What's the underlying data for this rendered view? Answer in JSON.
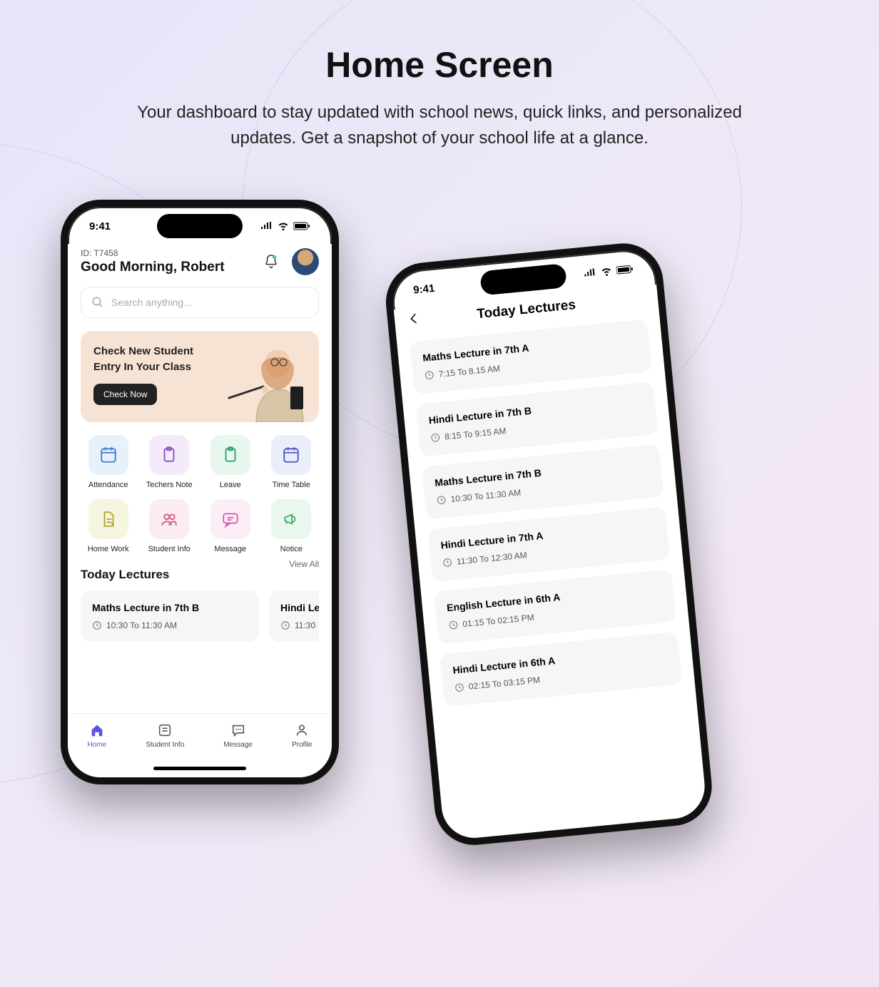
{
  "page": {
    "title": "Home Screen",
    "subtitle": "Your dashboard to stay updated with school news, quick links, and personalized updates. Get a snapshot of your school life at a glance."
  },
  "statusbar": {
    "time": "9:41"
  },
  "phone1": {
    "user_id": "ID: T7458",
    "greeting": "Good Morning, Robert",
    "search_placeholder": "Search anything...",
    "banner": {
      "title": "Check New Student Entry In Your Class",
      "button": "Check Now"
    },
    "tiles": [
      {
        "label": "Attendance",
        "bg": "#e6f1fb",
        "icon": "calendar",
        "iconColor": "#3f79d6"
      },
      {
        "label": "Techers Note",
        "bg": "#f5eaf9",
        "icon": "clipboard",
        "iconColor": "#8a4ec2"
      },
      {
        "label": "Leave",
        "bg": "#e7f7ee",
        "icon": "clipboard",
        "iconColor": "#2fa26b"
      },
      {
        "label": "Time Table",
        "bg": "#eaeefb",
        "icon": "calendar",
        "iconColor": "#4d54c6"
      },
      {
        "label": "Home Work",
        "bg": "#f6f5df",
        "icon": "document",
        "iconColor": "#b0a728"
      },
      {
        "label": "Student Info",
        "bg": "#fbecf1",
        "icon": "users",
        "iconColor": "#d45c88"
      },
      {
        "label": "Message",
        "bg": "#fceef7",
        "icon": "message",
        "iconColor": "#d15db5"
      },
      {
        "label": "Notice",
        "bg": "#eaf7ee",
        "icon": "megaphone",
        "iconColor": "#4aa868"
      }
    ],
    "today_lectures": {
      "heading": "Today Lectures",
      "view_all": "View All",
      "items": [
        {
          "title": "Maths Lecture in 7th B",
          "time": "10:30 To 11:30 AM"
        },
        {
          "title": "Hindi Le",
          "time": "11:30"
        }
      ]
    },
    "nav": [
      {
        "label": "Home",
        "active": true
      },
      {
        "label": "Student Info",
        "active": false
      },
      {
        "label": "Message",
        "active": false
      },
      {
        "label": "Profile",
        "active": false
      }
    ]
  },
  "phone2": {
    "title": "Today Lectures",
    "lectures": [
      {
        "title": "Maths Lecture in 7th A",
        "time": "7:15  To  8.15 AM"
      },
      {
        "title": "Hindi Lecture in 7th B",
        "time": "8:15  To  9:15 AM"
      },
      {
        "title": "Maths Lecture in 7th B",
        "time": "10:30  To  11:30 AM"
      },
      {
        "title": "Hindi Lecture in 7th A",
        "time": "11:30  To  12:30 AM"
      },
      {
        "title": "English Lecture in 6th A",
        "time": "01:15  To  02:15 PM"
      },
      {
        "title": "Hindi Lecture in 6th A",
        "time": "02:15  To  03:15 PM"
      }
    ]
  }
}
